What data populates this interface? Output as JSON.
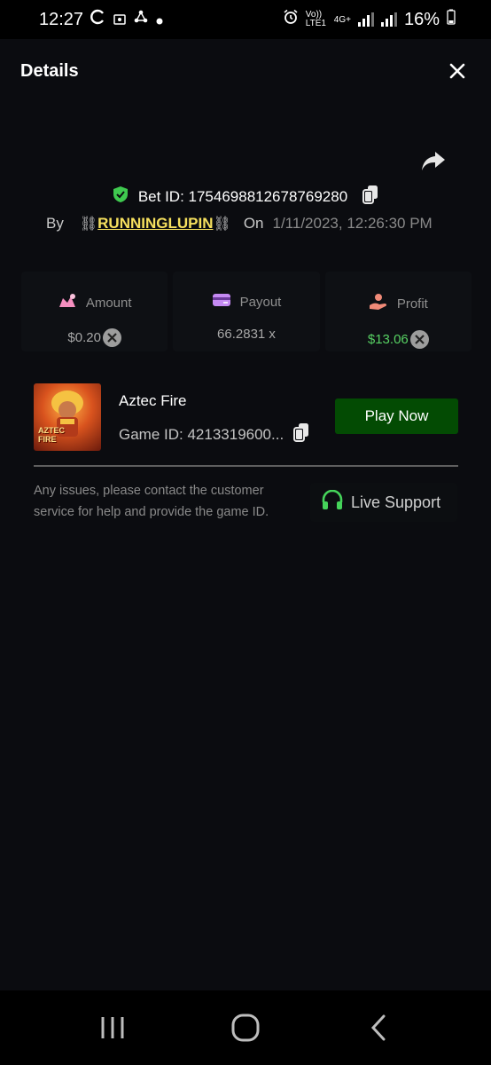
{
  "status_bar": {
    "time": "12:27",
    "network_label": "Vo)) LTE1",
    "network_type": "4G+",
    "battery": "16%"
  },
  "header": {
    "title": "Details"
  },
  "bet": {
    "bet_id": "Bet ID: 1754698812678769280",
    "by_label": "By",
    "username": "RUNNINGLUPIN",
    "chain_glyph": "⛓",
    "on_label": "On",
    "datetime": "1/11/2023, 12:26:30 PM"
  },
  "stats": {
    "amount": {
      "label": "Amount",
      "value": "$0.20"
    },
    "payout": {
      "label": "Payout",
      "value": "66.2831 x"
    },
    "profit": {
      "label": "Profit",
      "value": "$13.06"
    }
  },
  "game": {
    "name": "Aztec Fire",
    "game_id": "Game ID: 4213319600...",
    "thumb_text_line1": "AZTEC",
    "thumb_text_line2": "FIRE",
    "play_label": "Play Now"
  },
  "support": {
    "text": "Any issues, please contact the customer service for help and provide the game ID.",
    "button_label": "Live Support"
  },
  "colors": {
    "accent_green": "#57d163",
    "username_yellow": "#f6e05e",
    "play_button_bg": "#034b03"
  }
}
